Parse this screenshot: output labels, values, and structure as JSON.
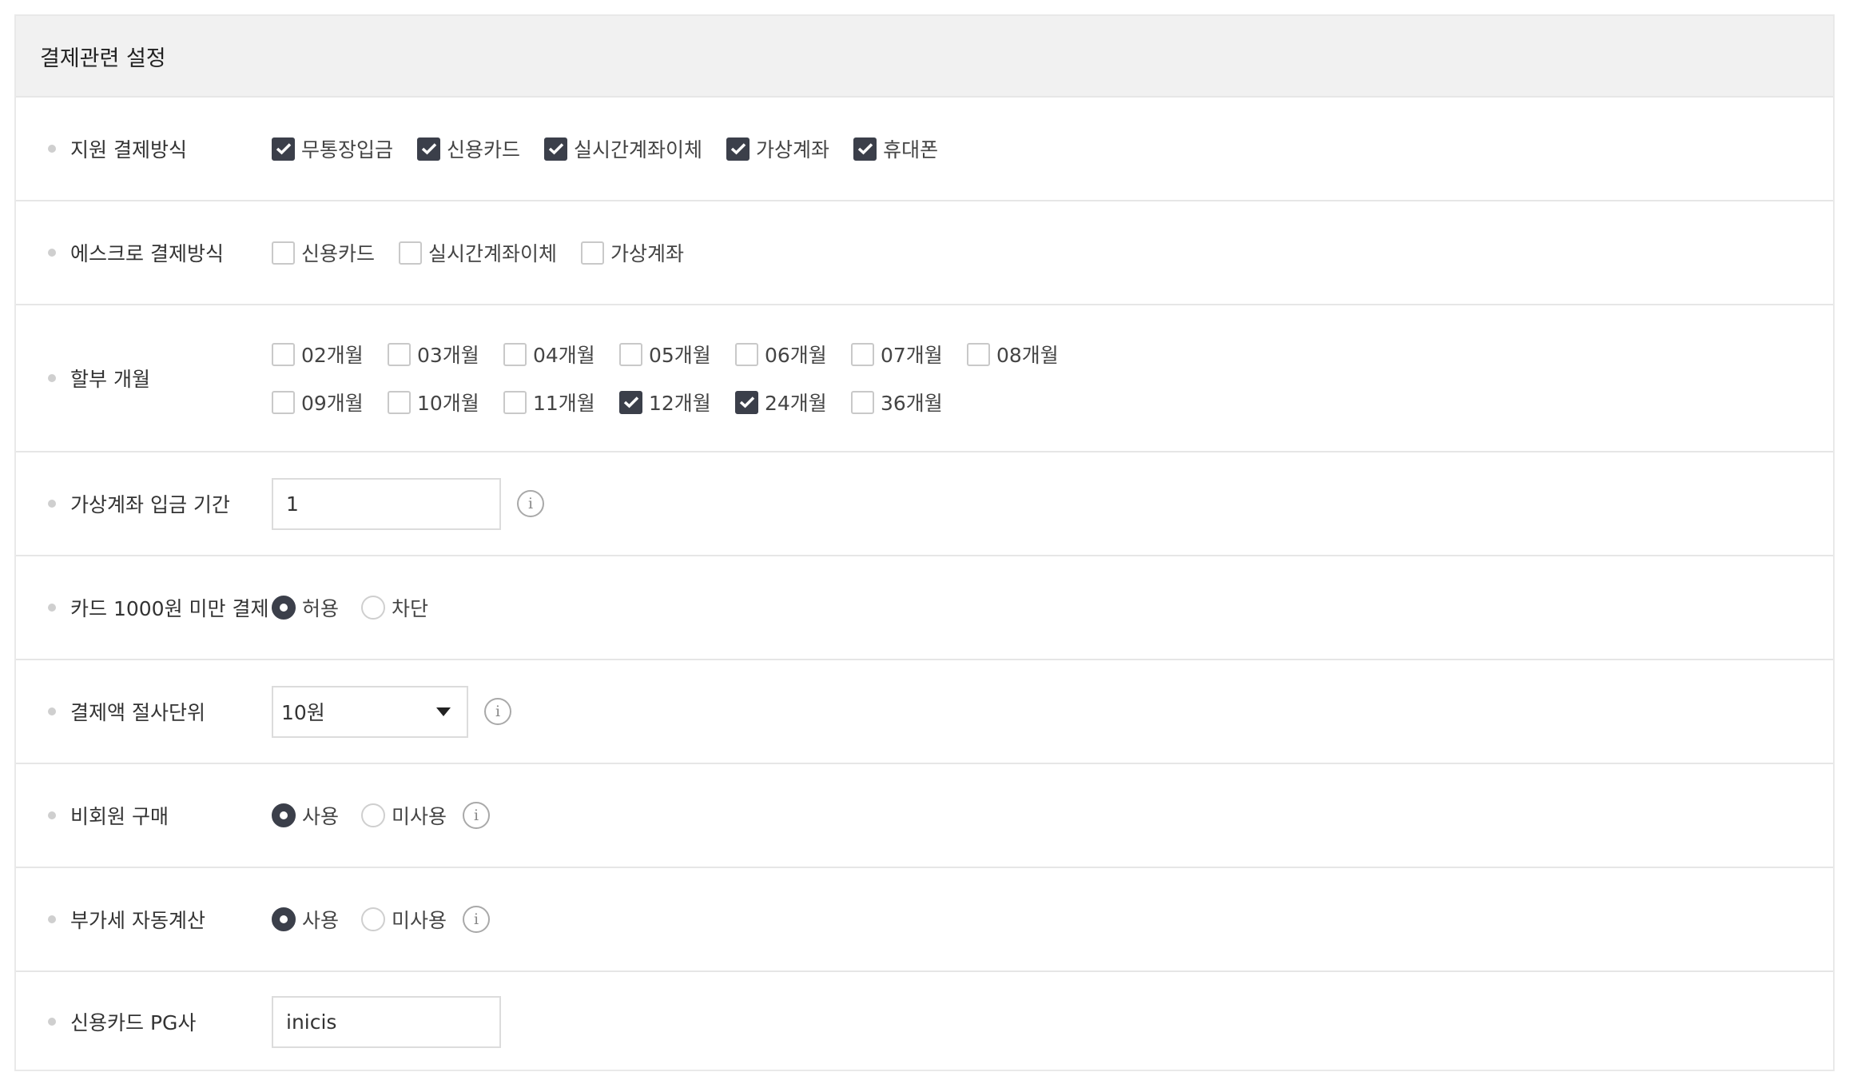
{
  "panel": {
    "title": "결제관련 설정"
  },
  "payment_methods": {
    "label": "지원 결제방식",
    "options": [
      {
        "label": "무통장입금",
        "checked": true
      },
      {
        "label": "신용카드",
        "checked": true
      },
      {
        "label": "실시간계좌이체",
        "checked": true
      },
      {
        "label": "가상계좌",
        "checked": true
      },
      {
        "label": "휴대폰",
        "checked": true
      }
    ]
  },
  "escrow_methods": {
    "label": "에스크로 결제방식",
    "options": [
      {
        "label": "신용카드",
        "checked": false
      },
      {
        "label": "실시간계좌이체",
        "checked": false
      },
      {
        "label": "가상계좌",
        "checked": false
      }
    ]
  },
  "installments": {
    "label": "할부 개월",
    "options": [
      {
        "label": "02개월",
        "checked": false
      },
      {
        "label": "03개월",
        "checked": false
      },
      {
        "label": "04개월",
        "checked": false
      },
      {
        "label": "05개월",
        "checked": false
      },
      {
        "label": "06개월",
        "checked": false
      },
      {
        "label": "07개월",
        "checked": false
      },
      {
        "label": "08개월",
        "checked": false
      },
      {
        "label": "09개월",
        "checked": false
      },
      {
        "label": "10개월",
        "checked": false
      },
      {
        "label": "11개월",
        "checked": false
      },
      {
        "label": "12개월",
        "checked": true
      },
      {
        "label": "24개월",
        "checked": true
      },
      {
        "label": "36개월",
        "checked": false
      }
    ]
  },
  "vaccount_period": {
    "label": "가상계좌 입금 기간",
    "value": "1"
  },
  "card_min": {
    "label": "카드 1000원 미만 결제",
    "options": [
      {
        "label": "허용",
        "checked": true
      },
      {
        "label": "차단",
        "checked": false
      }
    ]
  },
  "rounding_unit": {
    "label": "결제액 절사단위",
    "selected": "10원"
  },
  "guest_purchase": {
    "label": "비회원 구매",
    "options": [
      {
        "label": "사용",
        "checked": true
      },
      {
        "label": "미사용",
        "checked": false
      }
    ]
  },
  "vat_auto": {
    "label": "부가세 자동계산",
    "options": [
      {
        "label": "사용",
        "checked": true
      },
      {
        "label": "미사용",
        "checked": false
      }
    ]
  },
  "card_pg": {
    "label": "신용카드 PG사",
    "value": "inicis"
  },
  "icons": {
    "info": "i"
  },
  "colors": {
    "checked_fill": "#3b3f4a",
    "header_bg": "#f1f1f1",
    "border": "#e6e6e6"
  }
}
